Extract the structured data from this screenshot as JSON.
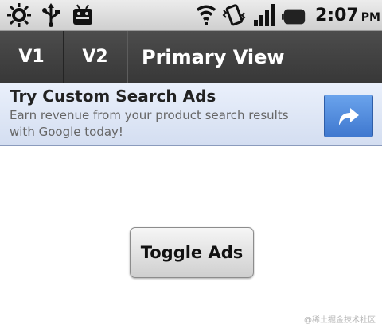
{
  "status_bar": {
    "icons": [
      "sun-settings-icon",
      "usb-icon",
      "android-debug-icon",
      "wifi-icon",
      "vibrate-icon",
      "signal-icon",
      "battery-icon"
    ],
    "time": "2:07",
    "ampm": "PM"
  },
  "action_bar": {
    "tabs": [
      {
        "label": "V1"
      },
      {
        "label": "V2"
      }
    ],
    "title": "Primary View"
  },
  "ad": {
    "title": "Try Custom Search Ads",
    "line1": "Earn revenue from your product search results",
    "line2": "with Google today!",
    "icon": "forward-arrow-icon"
  },
  "main": {
    "toggle_label": "Toggle Ads"
  },
  "watermark": "@稀土掘金技术社区",
  "colors": {
    "action_bar": "#3f3f3f",
    "ad_background": "#dfe7f6",
    "ad_button": "#4a84d8"
  }
}
